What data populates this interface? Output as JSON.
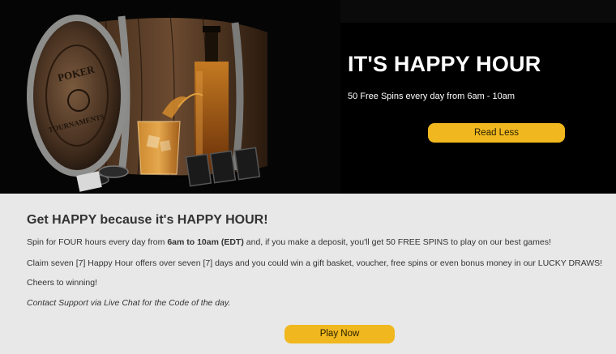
{
  "hero": {
    "title": "IT'S HAPPY HOUR",
    "subtitle": "50 Free Spins every day from 6am - 10am",
    "read_less_label": "Read Less",
    "barrel_text": "POKER TOURNAMENTS"
  },
  "content": {
    "heading": "Get HAPPY because it's HAPPY HOUR!",
    "paragraph1": {
      "before": "Spin for FOUR hours every day from ",
      "bold": "6am to 10am (EDT)",
      "after": " and, if you make a deposit, you'll get 50 FREE SPINS to play on our best games!"
    },
    "paragraph2": "Claim seven [7] Happy Hour offers over seven [7] days and you could win a gift basket, voucher, free spins or even bonus money in our LUCKY DRAWS!",
    "paragraph3": "Cheers to winning!",
    "paragraph4": "Contact Support via Live Chat for the Code of the day.",
    "play_now_label": "Play Now"
  },
  "colors": {
    "accent": "#f0b81e",
    "hero_bg": "#000000",
    "content_bg": "#e8e8e8",
    "text": "#333333"
  }
}
